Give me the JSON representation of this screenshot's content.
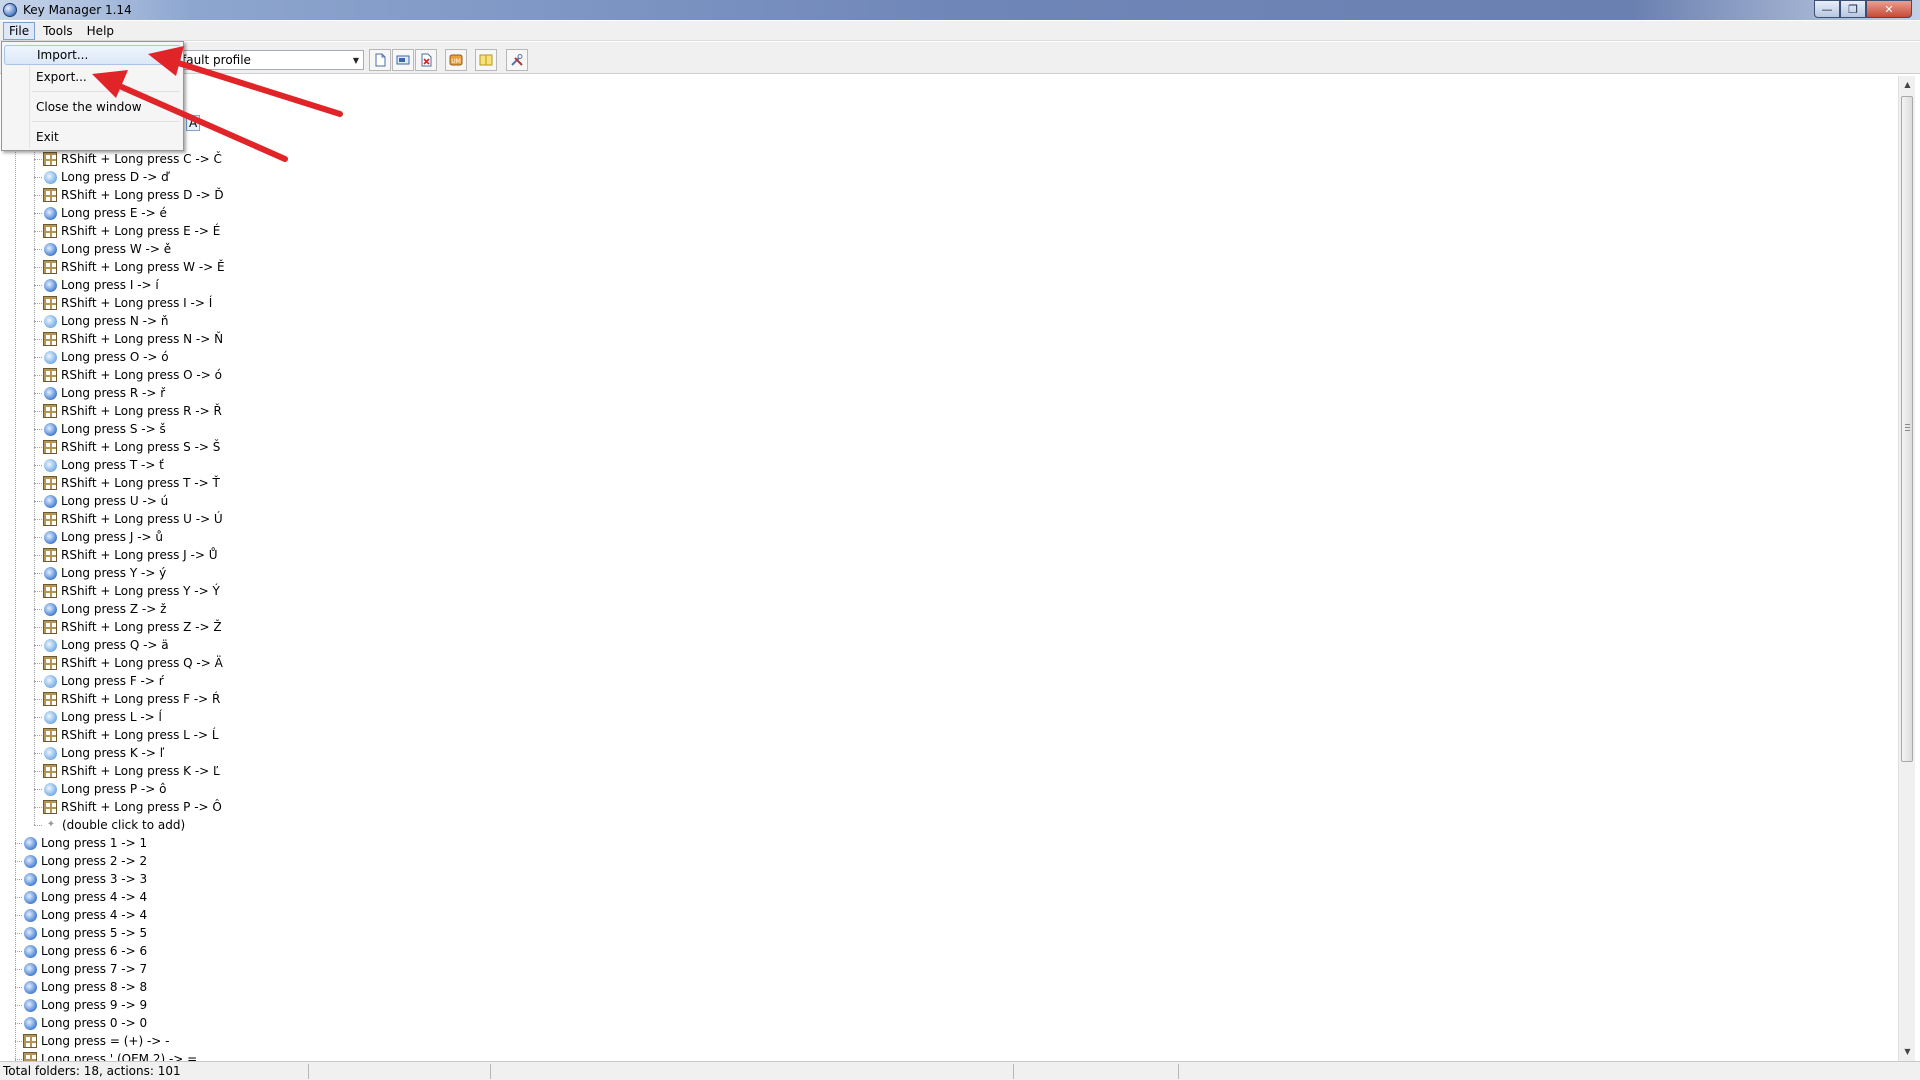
{
  "window": {
    "title": "Key Manager 1.14"
  },
  "menubar": {
    "items": [
      "File",
      "Tools",
      "Help"
    ]
  },
  "file_menu": {
    "items": [
      "Import...",
      "Export...",
      "Close the window",
      "Exit"
    ]
  },
  "toolbar": {
    "profile_value": "fault profile"
  },
  "tree": {
    "partial_row": "A",
    "children": [
      {
        "icon": "grid",
        "label": "RShift + Long press C -> Č"
      },
      {
        "icon": "blue-ex",
        "label": "Long press D -> ď"
      },
      {
        "icon": "grid",
        "label": "RShift + Long press D -> Ď"
      },
      {
        "icon": "blue",
        "label": "Long press E -> é"
      },
      {
        "icon": "grid",
        "label": "RShift + Long press E -> É"
      },
      {
        "icon": "blue",
        "label": "Long press W -> ě"
      },
      {
        "icon": "grid",
        "label": "RShift + Long press W -> Ě"
      },
      {
        "icon": "blue",
        "label": "Long press I -> í"
      },
      {
        "icon": "grid",
        "label": "RShift + Long press I -> Í"
      },
      {
        "icon": "blue-ex",
        "label": "Long press N -> ň"
      },
      {
        "icon": "grid",
        "label": "RShift + Long press N -> Ň"
      },
      {
        "icon": "blue-ex",
        "label": "Long press O -> ó"
      },
      {
        "icon": "grid",
        "label": "RShift + Long press O -> ó"
      },
      {
        "icon": "blue",
        "label": "Long press R -> ř"
      },
      {
        "icon": "grid",
        "label": "RShift + Long press R -> Ř"
      },
      {
        "icon": "blue",
        "label": "Long press S -> š"
      },
      {
        "icon": "grid",
        "label": "RShift + Long press S -> Š"
      },
      {
        "icon": "blue-ex",
        "label": "Long press T -> ť"
      },
      {
        "icon": "grid",
        "label": "RShift + Long press T -> Ť"
      },
      {
        "icon": "blue",
        "label": "Long press U -> ú"
      },
      {
        "icon": "grid",
        "label": "RShift + Long press U -> Ú"
      },
      {
        "icon": "blue",
        "label": "Long press J -> ů"
      },
      {
        "icon": "grid",
        "label": "RShift + Long press J -> Ů"
      },
      {
        "icon": "blue",
        "label": "Long press Y -> ý"
      },
      {
        "icon": "grid",
        "label": "RShift + Long press Y -> Ý"
      },
      {
        "icon": "blue",
        "label": "Long press Z -> ž"
      },
      {
        "icon": "grid",
        "label": "RShift + Long press Z -> Ž"
      },
      {
        "icon": "blue-ex",
        "label": "Long press Q -> ä"
      },
      {
        "icon": "grid",
        "label": "RShift + Long press Q -> Ä"
      },
      {
        "icon": "blue-ex",
        "label": "Long press F -> ŕ"
      },
      {
        "icon": "grid",
        "label": "RShift + Long press F -> Ŕ"
      },
      {
        "icon": "blue-ex",
        "label": "Long press L -> ĺ"
      },
      {
        "icon": "grid",
        "label": "RShift + Long press L -> Ĺ"
      },
      {
        "icon": "blue-ex",
        "label": "Long press K -> ľ"
      },
      {
        "icon": "grid",
        "label": "RShift + Long press K -> Ľ"
      },
      {
        "icon": "blue-ex",
        "label": "Long press P -> ô"
      },
      {
        "icon": "grid",
        "label": "RShift + Long press P -> Ô"
      },
      {
        "icon": "star",
        "label": "(double click to add)"
      }
    ],
    "top_level": [
      {
        "icon": "blue",
        "label": "Long press 1 -> 1"
      },
      {
        "icon": "blue",
        "label": "Long press 2 -> 2"
      },
      {
        "icon": "blue",
        "label": "Long press 3 -> 3"
      },
      {
        "icon": "blue",
        "label": "Long press 4 -> 4"
      },
      {
        "icon": "blue",
        "label": "Long press 4 -> 4"
      },
      {
        "icon": "blue",
        "label": "Long press 5 -> 5"
      },
      {
        "icon": "blue",
        "label": "Long press 6 -> 6"
      },
      {
        "icon": "blue",
        "label": "Long press 7 -> 7"
      },
      {
        "icon": "blue",
        "label": "Long press 8 -> 8"
      },
      {
        "icon": "blue",
        "label": "Long press 9 -> 9"
      },
      {
        "icon": "blue",
        "label": "Long press 0 -> 0"
      },
      {
        "icon": "grid",
        "label": "Long press = (+) -> -"
      },
      {
        "icon": "grid",
        "label": "Long press ' (OEM 2) -> ="
      }
    ]
  },
  "statusbar": {
    "text": "Total folders: 18, actions: 101"
  },
  "colors": {
    "arrow": "#e02428",
    "menu_highlight": "#dce8f8"
  }
}
